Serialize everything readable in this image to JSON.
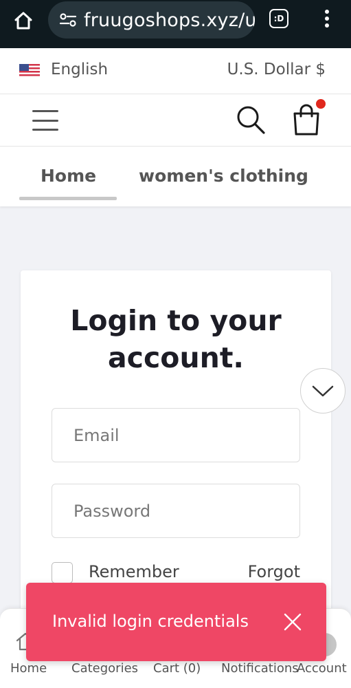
{
  "browser": {
    "url": "fruugoshops.xyz/u",
    "extension_label": ":D"
  },
  "top_bar": {
    "language": "English",
    "currency": "U.S. Dollar $"
  },
  "nav": {
    "tabs": [
      {
        "label": "Home",
        "active": true
      },
      {
        "label": "women's clothing",
        "active": false
      }
    ]
  },
  "login": {
    "title": "Login to your account.",
    "email_placeholder": "Email",
    "password_placeholder": "Password",
    "remember_label": "Remember",
    "forgot_label": "Forgot"
  },
  "bottom_nav": {
    "items": [
      {
        "label": "Home"
      },
      {
        "label": "Categories"
      },
      {
        "label": "Cart (0)"
      },
      {
        "label": "Notifications"
      },
      {
        "label": "Account"
      }
    ]
  },
  "toast": {
    "message": "Invalid login credentials"
  },
  "colors": {
    "toast_bg": "#ef4765",
    "cart_badge": "#e0281d",
    "browser_bar": "#0f1a1f",
    "page_bg": "#f1f2f6"
  },
  "icons": [
    "home-icon",
    "tune-icon",
    "extension-icon",
    "more-vert-icon",
    "us-flag-icon",
    "hamburger-icon",
    "search-icon",
    "shopping-bag-icon",
    "chevron-down-icon",
    "close-icon",
    "account-icon"
  ]
}
